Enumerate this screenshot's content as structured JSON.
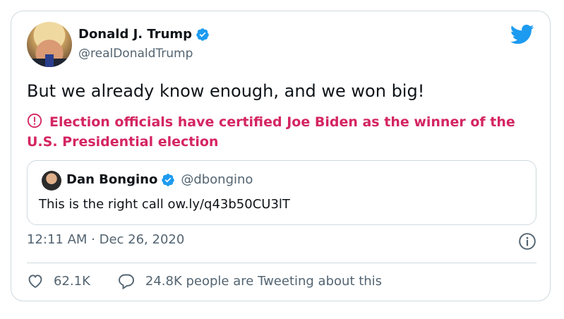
{
  "author": {
    "name": "Donald J. Trump",
    "handle": "@realDonaldTrump"
  },
  "tweet": {
    "text": "But we already know enough, and we won big!",
    "warning": "Election officials have certified Joe Biden as the winner of the U.S. Presidential election",
    "timestamp": "12:11 AM · Dec 26, 2020"
  },
  "quoted": {
    "name": "Dan Bongino",
    "handle": "@dbongino",
    "text": "This is the right call ow.ly/q43b50CU3lT"
  },
  "stats": {
    "likes": "62.1K",
    "tweeting": "24.8K people are Tweeting about this"
  },
  "colors": {
    "warning": "#d42562",
    "verified": "#1d9bf0",
    "muted": "#536471",
    "border": "#cfd9de"
  },
  "icons": [
    "verified-badge-icon",
    "twitter-bird-icon",
    "warning-icon",
    "info-icon",
    "heart-icon",
    "reply-bubble-icon"
  ]
}
